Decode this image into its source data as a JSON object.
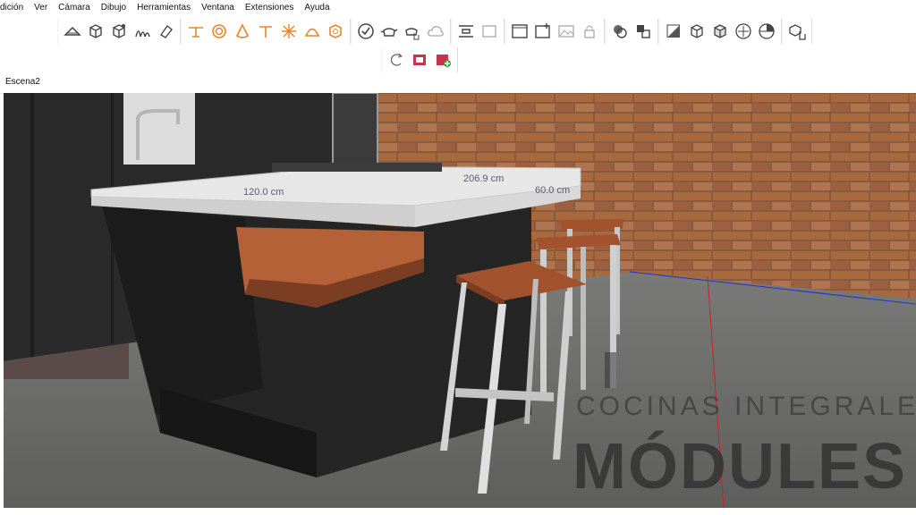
{
  "menu": [
    "dición",
    "Ver",
    "Cámara",
    "Dibujo",
    "Herramientas",
    "Ventana",
    "Extensiones",
    "Ayuda"
  ],
  "scenes": [
    "Escena2"
  ],
  "dimensions": {
    "width_dim": "120.0 cm",
    "length_dim": "206.9 cm",
    "depth_dim": "60.0 cm"
  },
  "watermark": {
    "line1": "COCINAS INTEGRALES",
    "line2": "MÓDULES"
  },
  "colors": {
    "accent_orange": "#e8852a",
    "axis_red": "#cc2222",
    "axis_blue": "#2233cc"
  },
  "toolbar_icons": [
    "section-plane-icon",
    "component-icon",
    "dynamic-component-icon",
    "sandbox-icon",
    "eraser-icon",
    "roof-icon",
    "circle-icon",
    "cone-icon",
    "lamp-icon",
    "sun-icon",
    "dome-icon",
    "box-icon",
    "validate-icon",
    "teapot-icon",
    "teapot-hand-icon",
    "cloud-icon",
    "layout-icon",
    "frame-icon",
    "window-icon",
    "window-add-icon",
    "window-image-icon",
    "lock-icon",
    "intersect-icon",
    "move-component-icon",
    "xray-icon",
    "wireframe-icon",
    "hidden-line-icon",
    "shaded-icon",
    "textured-icon",
    "monochrome-icon",
    "component-hand-icon"
  ],
  "toolbar_row2_icons": [
    "reload-icon",
    "warehouse-icon",
    "extension-add-icon"
  ]
}
